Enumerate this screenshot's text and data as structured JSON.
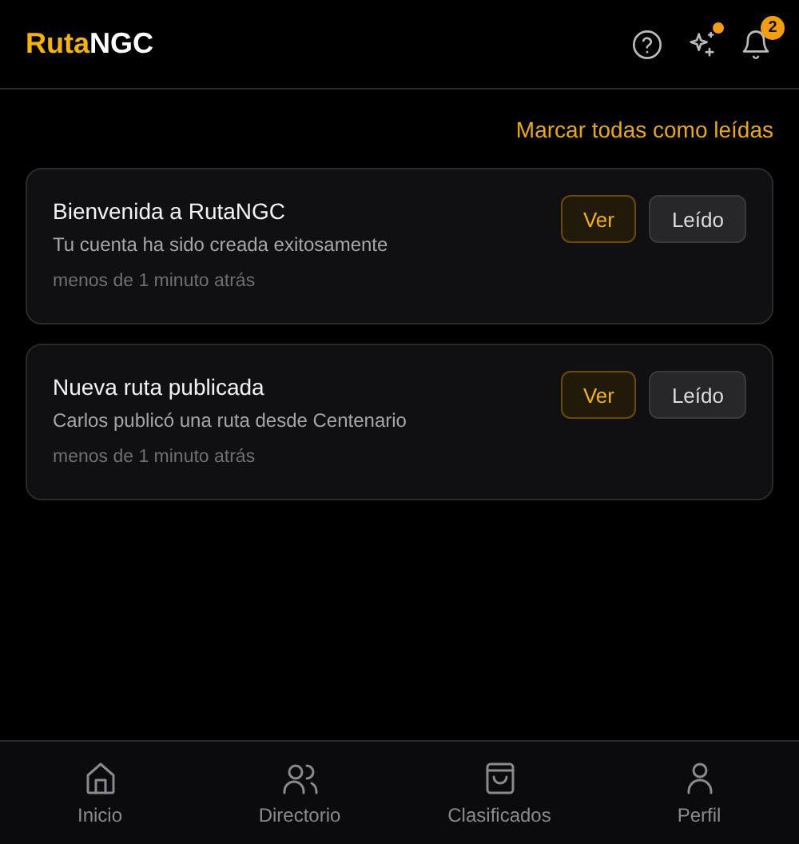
{
  "header": {
    "logo_accent": "Ruta",
    "logo_rest": "NGC",
    "sparkle_dot": true,
    "notification_count": "2"
  },
  "mark_all_link": "Marcar todas como leídas",
  "notifications": [
    {
      "title": "Bienvenida a RutaNGC",
      "message": "Tu cuenta ha sido creada exitosamente",
      "time": "menos de 1 minuto atrás",
      "view_label": "Ver",
      "read_label": "Leído"
    },
    {
      "title": "Nueva ruta publicada",
      "message": "Carlos publicó una ruta desde Centenario",
      "time": "menos de 1 minuto atrás",
      "view_label": "Ver",
      "read_label": "Leído"
    }
  ],
  "bottom_nav": [
    {
      "kind": "home",
      "label": "Inicio",
      "selected": false
    },
    {
      "kind": "people",
      "label": "Directorio",
      "selected": false
    },
    {
      "kind": "bag",
      "label": "Clasificados",
      "selected": false
    },
    {
      "kind": "user",
      "label": "Perfil",
      "selected": false
    }
  ]
}
